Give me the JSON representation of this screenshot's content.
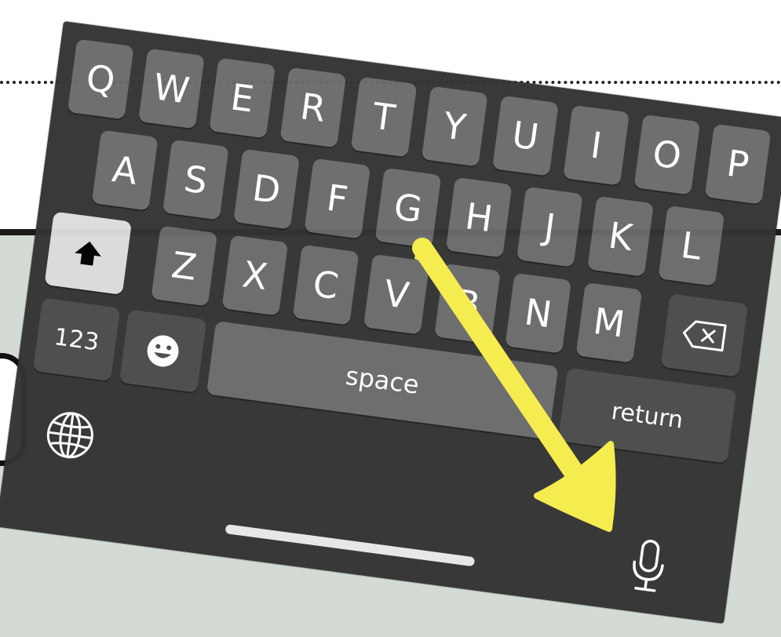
{
  "keyboard": {
    "rows": [
      [
        "Q",
        "W",
        "E",
        "R",
        "T",
        "Y",
        "U",
        "I",
        "O",
        "P"
      ],
      [
        "A",
        "S",
        "D",
        "F",
        "G",
        "H",
        "J",
        "K",
        "L"
      ],
      [
        "Z",
        "X",
        "C",
        "V",
        "B",
        "N",
        "M"
      ]
    ],
    "numbers_label": "123",
    "space_label": "space",
    "return_label": "return"
  },
  "icons": {
    "shift": "shift-arrow-icon",
    "delete": "backspace-icon",
    "emoji": "emoji-smiley-icon",
    "globe": "globe-icon",
    "mic": "microphone-icon",
    "annotation": "yellow-arrow-annotation"
  },
  "colors": {
    "keyboard_bg": "#333333",
    "key_bg": "#6b6b6b",
    "func_key_bg": "#4b4b4b",
    "shift_bg": "#dcdcdc",
    "arrow": "#f5ec4f",
    "page_bg_lower": "#d3dbd4"
  }
}
